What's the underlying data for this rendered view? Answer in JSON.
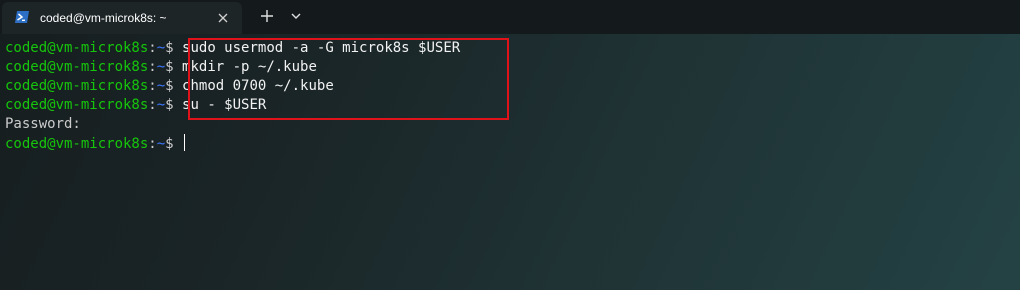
{
  "tab": {
    "title": "coded@vm-microk8s: ~",
    "icon": "powershell-terminal-icon",
    "close_icon": "close-icon"
  },
  "tabbar": {
    "new_tab_icon": "plus-icon",
    "dropdown_icon": "chevron-down-icon"
  },
  "colors": {
    "prompt_user": "#16c60c",
    "prompt_path": "#3b78ff",
    "highlight": "#e0131a"
  },
  "terminal": {
    "lines": [
      {
        "user": "coded@vm-microk8s",
        "sep": ":",
        "path": "~",
        "sym": "$ ",
        "cmd": "sudo usermod -a -G microk8s $USER"
      },
      {
        "user": "coded@vm-microk8s",
        "sep": ":",
        "path": "~",
        "sym": "$ ",
        "cmd": "mkdir -p ~/.kube"
      },
      {
        "user": "coded@vm-microk8s",
        "sep": ":",
        "path": "~",
        "sym": "$ ",
        "cmd": "chmod 0700 ~/.kube"
      },
      {
        "user": "coded@vm-microk8s",
        "sep": ":",
        "path": "~",
        "sym": "$ ",
        "cmd": "su - $USER"
      },
      {
        "text": "Password:"
      },
      {
        "user": "coded@vm-microk8s",
        "sep": ":",
        "path": "~",
        "sym": "$ ",
        "cmd": ""
      }
    ]
  }
}
